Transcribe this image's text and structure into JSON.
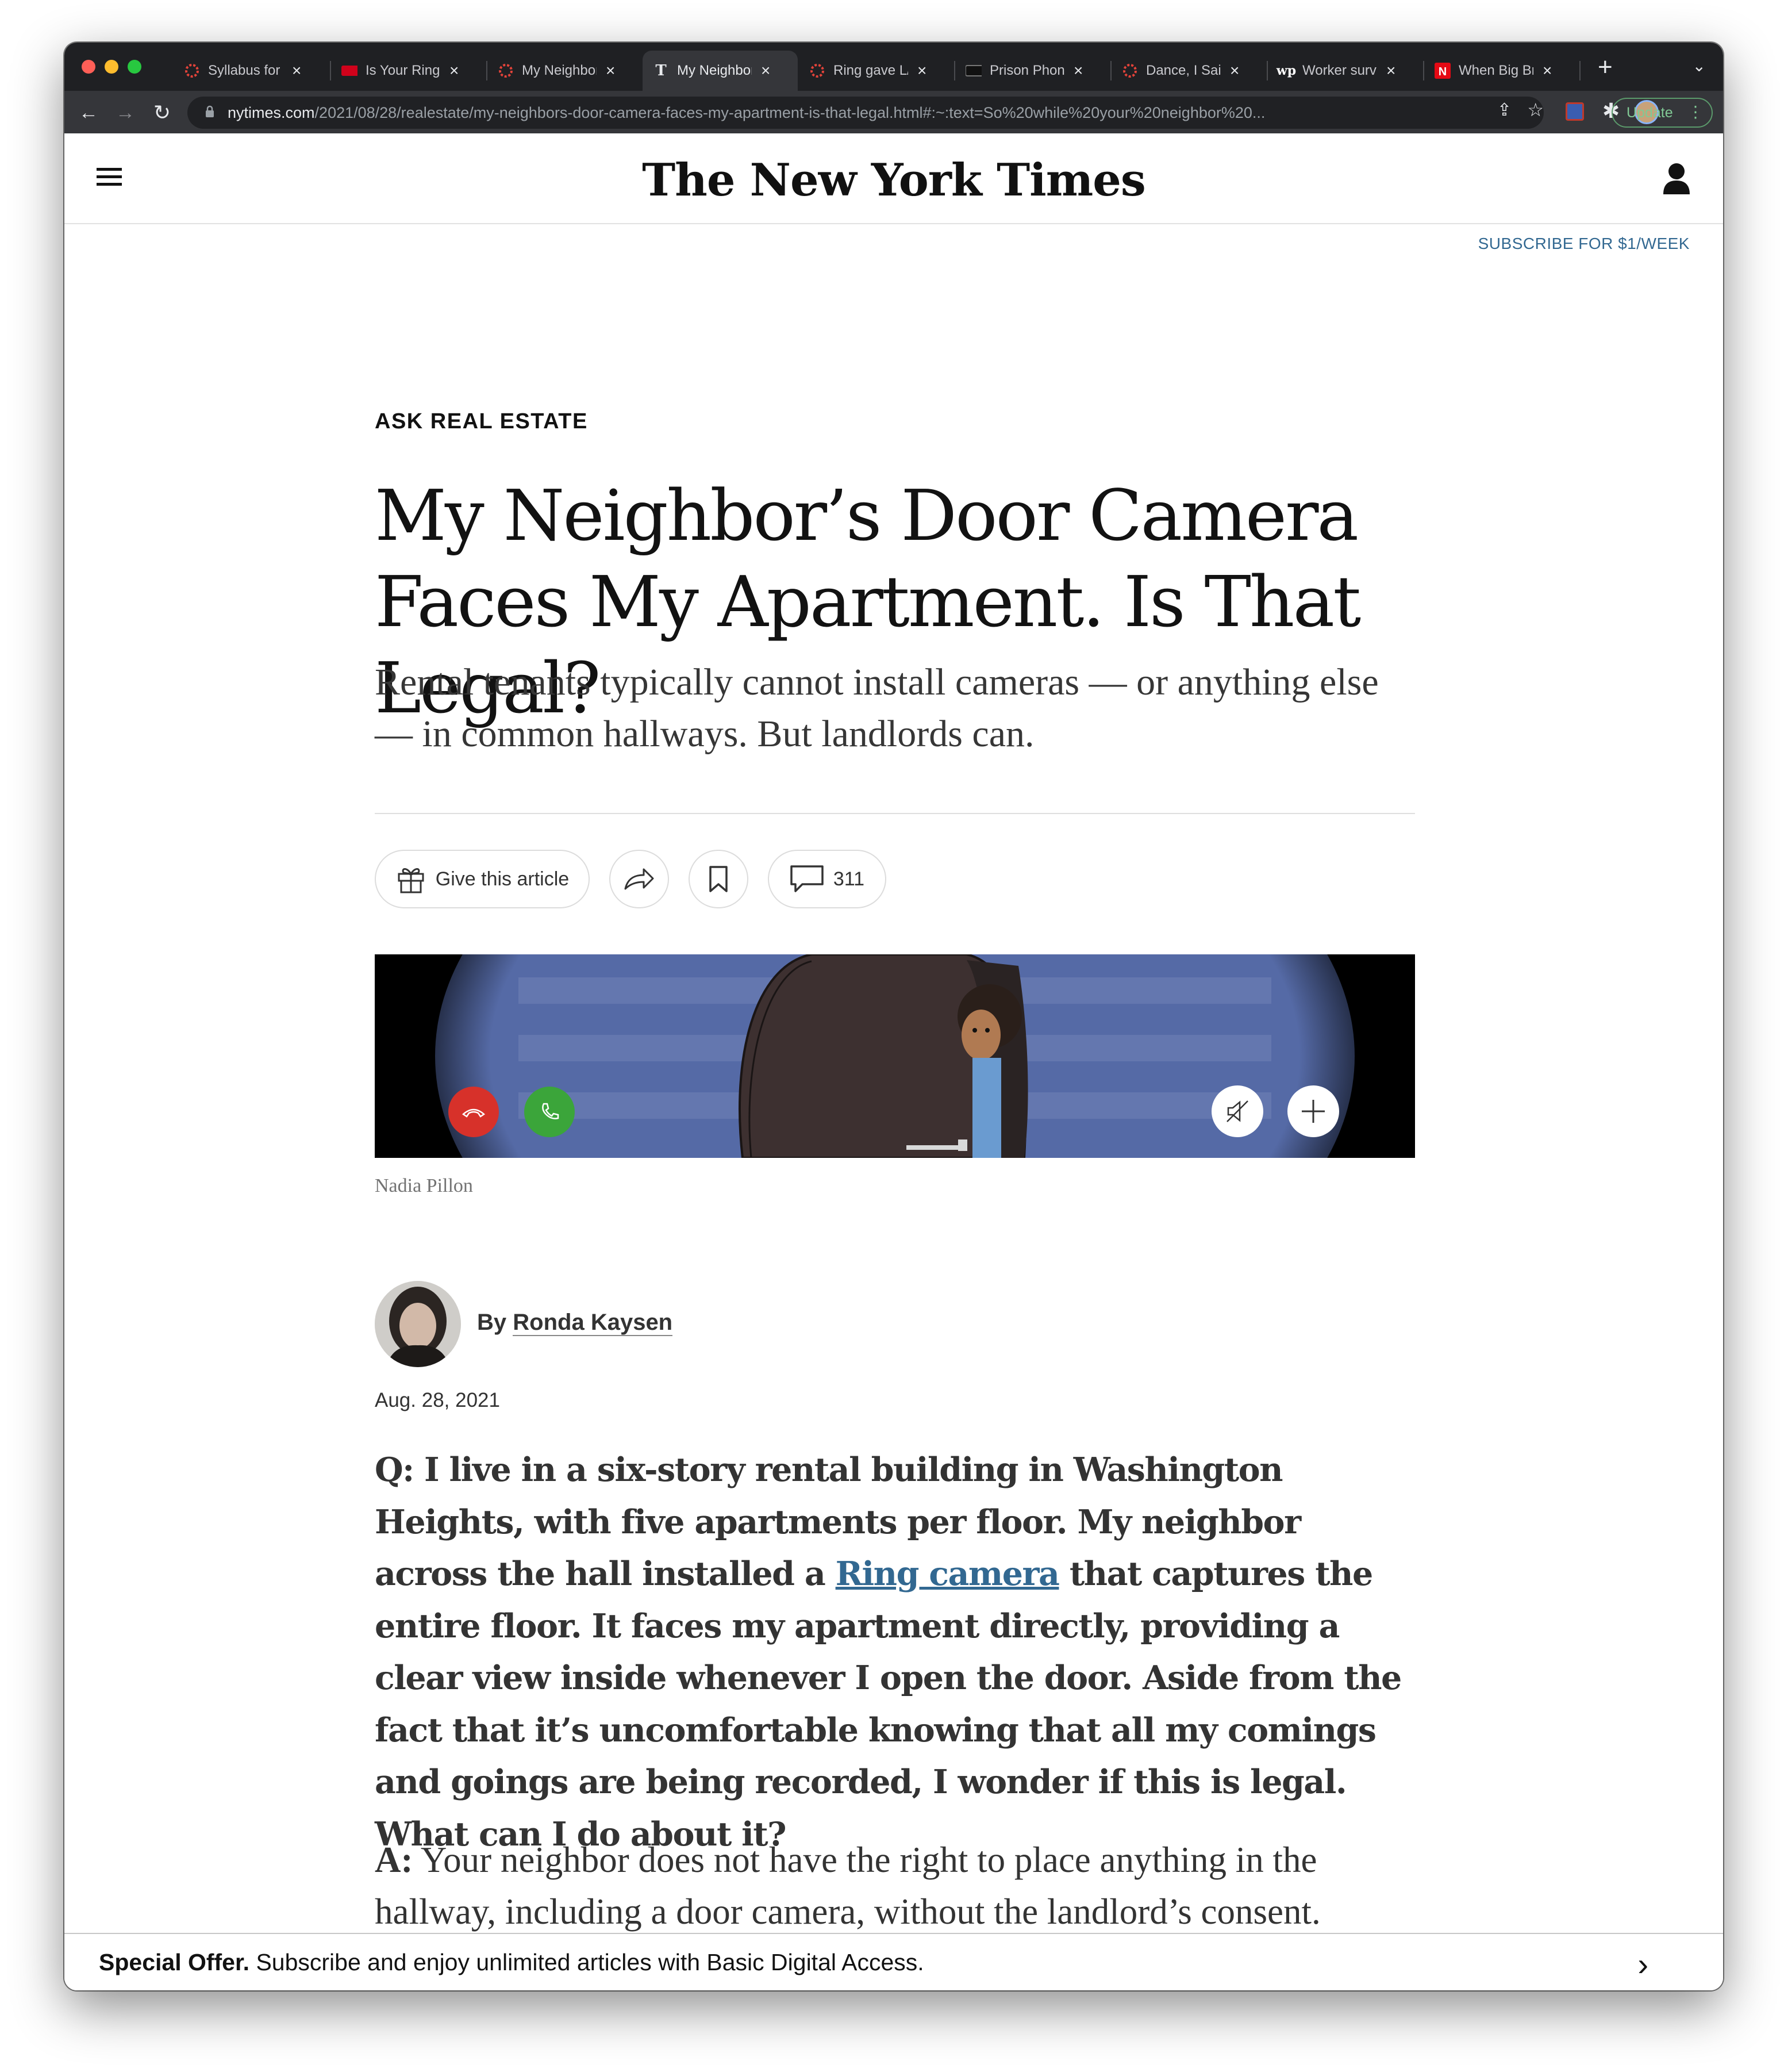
{
  "browser": {
    "tabs": [
      {
        "title": "Syllabus for",
        "icon": "ring-favicon-icon"
      },
      {
        "title": "Is Your Ring",
        "icon": "news-favicon-icon"
      },
      {
        "title": "My Neighbor",
        "icon": "ring-favicon-icon"
      },
      {
        "title": "My Neighbor",
        "icon": "nyt-favicon-icon",
        "active": true
      },
      {
        "title": "Ring gave L/",
        "icon": "ring-favicon-icon"
      },
      {
        "title": "Prison Phone",
        "icon": "site-favicon-icon"
      },
      {
        "title": "Dance, I Said",
        "icon": "ring-favicon-icon"
      },
      {
        "title": "Worker surv",
        "icon": "wp-favicon-icon"
      },
      {
        "title": "When Big Br",
        "icon": "netflix-favicon-icon"
      }
    ],
    "new_tab": "+",
    "url_domain": "nytimes.com",
    "url_path": "/2021/08/28/realestate/my-neighbors-door-camera-faces-my-apartment-is-that-legal.html#:~:text=So%20while%20your%20neighbor%20...",
    "update_label": "Update"
  },
  "site": {
    "logo": "The New York Times",
    "subscribe": "SUBSCRIBE FOR $1/WEEK"
  },
  "article": {
    "kicker": "ASK REAL ESTATE",
    "headline": "My Neighbor’s Door Camera Faces My Apartment. Is That Legal?",
    "summary": "Rental tenants typically cannot install cameras — or anything else — in common hallways. But landlords can.",
    "give_label": "Give this article",
    "comments_count": "311",
    "image_credit": "Nadia Pillon",
    "byline_prefix": "By",
    "author": "Ronda Kaysen",
    "date": "Aug. 28, 2021",
    "question_before": "Q: I live in a six-story rental building in Washington Heights, with five apartments per floor. My neighbor across the hall installed a ",
    "question_link": "Ring camera",
    "question_after": " that captures the entire floor. It faces my apartment directly, providing a clear view inside whenever I open the door. Aside from the fact that it’s uncomfortable knowing that all my comings and goings are being recorded, I wonder if this is legal. What can I do about it?",
    "answer_label": "A:",
    "answer_text": " Your neighbor does not have the right to place anything in the hallway, including a door camera, without the landlord’s consent."
  },
  "offer": {
    "bold": "Special Offer.",
    "text": " Subscribe and enjoy unlimited articles with Basic Digital Access."
  },
  "colors": {
    "link": "#326891",
    "decline": "#d7312a",
    "accept": "#3ba53a"
  }
}
